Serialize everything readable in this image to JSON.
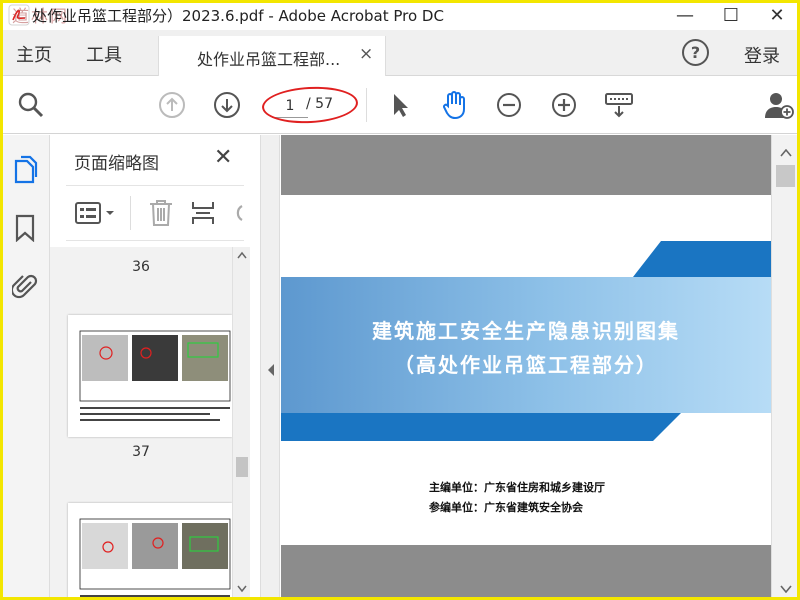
{
  "window": {
    "title": "处作业吊篮工程部分）2023.6.pdf - Adobe Acrobat Pro DC",
    "watermark": "道林网",
    "min": "—",
    "max": "☐",
    "close": "✕"
  },
  "menu": {
    "home": "主页",
    "tools": "工具",
    "tab_label": "处作业吊篮工程部...",
    "tab_close": "×",
    "help": "?",
    "login": "登录"
  },
  "toolbar": {
    "current_page": "1",
    "total_pages": "/ 57"
  },
  "panel": {
    "title": "页面缩略图",
    "close": "✕",
    "thumbnails": [
      {
        "label": "36"
      },
      {
        "label": "37"
      }
    ]
  },
  "document": {
    "cover_title_line1": "建筑施工安全生产隐患识别图集",
    "cover_title_line2": "（高处作业吊篮工程部分）",
    "chief_editor": "主编单位：广东省住房和城乡建设厅",
    "co_editor": "参编单位：广东省建筑安全协会"
  },
  "colors": {
    "accent": "#1473e6",
    "cover_blue": "#1a75c2",
    "annotation_red": "#e02020",
    "frame_yellow": "#f3e600"
  }
}
